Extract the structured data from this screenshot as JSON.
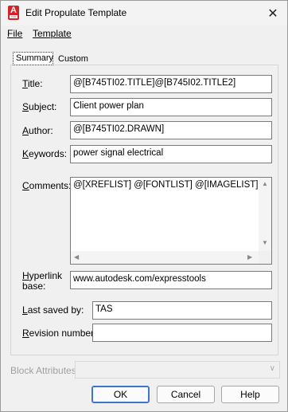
{
  "window": {
    "title": "Edit Propulate Template",
    "app_icon_letter": "A",
    "app_icon_strip": "CAD",
    "close_symbol": "✕"
  },
  "menu": {
    "file": {
      "mnemonic": "F",
      "rest": "ile"
    },
    "template": {
      "mnemonic": "T",
      "rest": "emplate"
    }
  },
  "tabs": {
    "summary": "Summary",
    "custom": "Custom"
  },
  "fields": {
    "title": {
      "label_mnemonic": "T",
      "label_rest": "itle:",
      "value": "@[B745TI02.TITLE]@[B745I02.TITLE2]"
    },
    "subject": {
      "label_mnemonic": "S",
      "label_rest": "ubject:",
      "value": "Client power plan"
    },
    "author": {
      "label_mnemonic": "A",
      "label_rest": "uthor:",
      "value": "@[B745TI02.DRAWN]"
    },
    "keywords": {
      "label_mnemonic": "K",
      "label_rest": "eywords:",
      "value": "power signal electrical"
    },
    "comments": {
      "label_mnemonic": "C",
      "label_rest": "omments:",
      "value": "@[XREFLIST] @[FONTLIST] @[IMAGELIST]"
    },
    "hyperlink": {
      "label_mnemonic": "H",
      "label_rest": "yperlink",
      "label_line2": "base:",
      "value": "www.autodesk.com/expresstools"
    },
    "last_saved_by": {
      "label_mnemonic": "L",
      "label_rest": "ast saved by:",
      "value": "TAS"
    },
    "revision": {
      "label_mnemonic": "R",
      "label_rest": "evision number:",
      "value": ""
    }
  },
  "block_attributes": {
    "label": "Block Attributes:",
    "value": ""
  },
  "buttons": {
    "ok": "OK",
    "cancel": "Cancel",
    "help": "Help"
  },
  "icons": {
    "scroll_up": "▲",
    "scroll_down": "▼",
    "scroll_left": "◀",
    "scroll_right": "▶",
    "dropdown": "∨"
  },
  "colors": {
    "app_icon": "#d2232a",
    "primary_button_border": "#3d76c8"
  }
}
